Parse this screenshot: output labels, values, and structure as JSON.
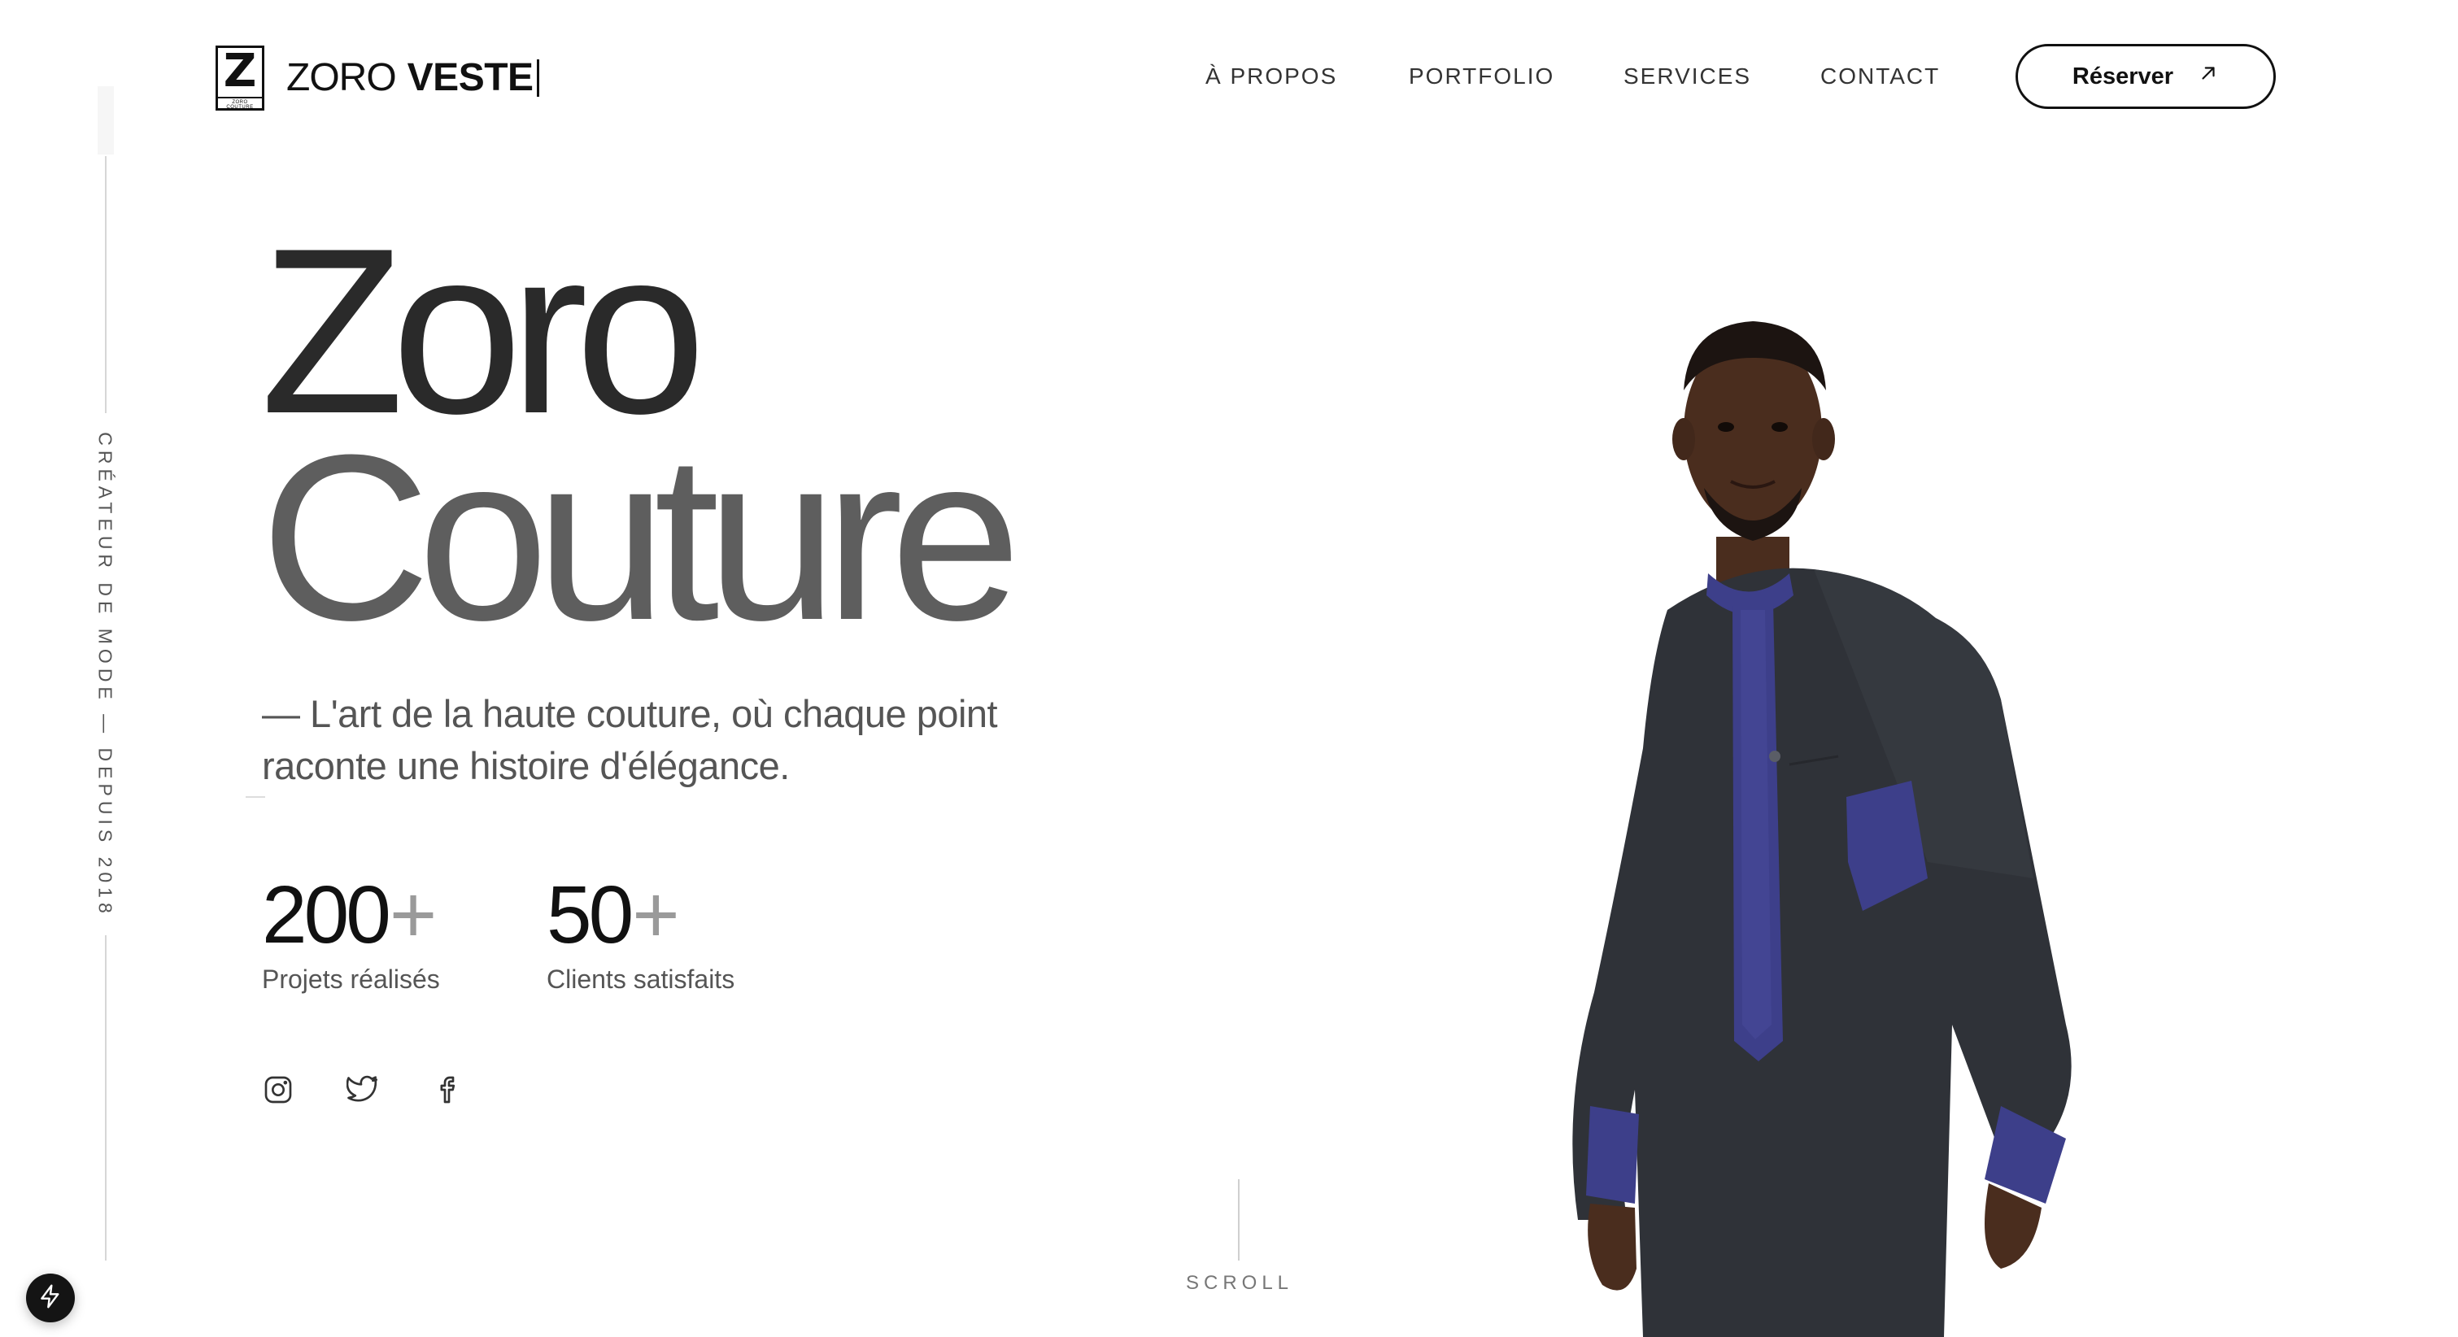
{
  "brand": {
    "mark_letter": "Z",
    "mark_caption": "ZORO COUTURE",
    "name_light": "ZORO",
    "name_bold": "VESTE"
  },
  "nav": {
    "items": [
      {
        "label": "À PROPOS"
      },
      {
        "label": "PORTFOLIO"
      },
      {
        "label": "SERVICES"
      },
      {
        "label": "CONTACT"
      }
    ],
    "cta_label": "Réserver"
  },
  "rail": {
    "text": "CRÉATEUR DE MODE — DEPUIS 2018"
  },
  "hero": {
    "title_line1": "Zoro",
    "title_line2": "Couture",
    "tagline": "— L'art de la haute couture, où chaque point raconte une histoire d'élégance."
  },
  "stats": [
    {
      "value": "200",
      "suffix": "+",
      "label": "Projets réalisés"
    },
    {
      "value": "50",
      "suffix": "+",
      "label": "Clients satisfaits"
    }
  ],
  "social": [
    {
      "icon": "instagram-icon"
    },
    {
      "icon": "twitter-icon"
    },
    {
      "icon": "facebook-icon"
    }
  ],
  "scroll_label": "SCROLL",
  "colors": {
    "text_dark": "#2a2a2a",
    "text_mid": "#5e5e5e",
    "garment_dark": "#2f3238",
    "garment_accent": "#3d3f8a"
  }
}
